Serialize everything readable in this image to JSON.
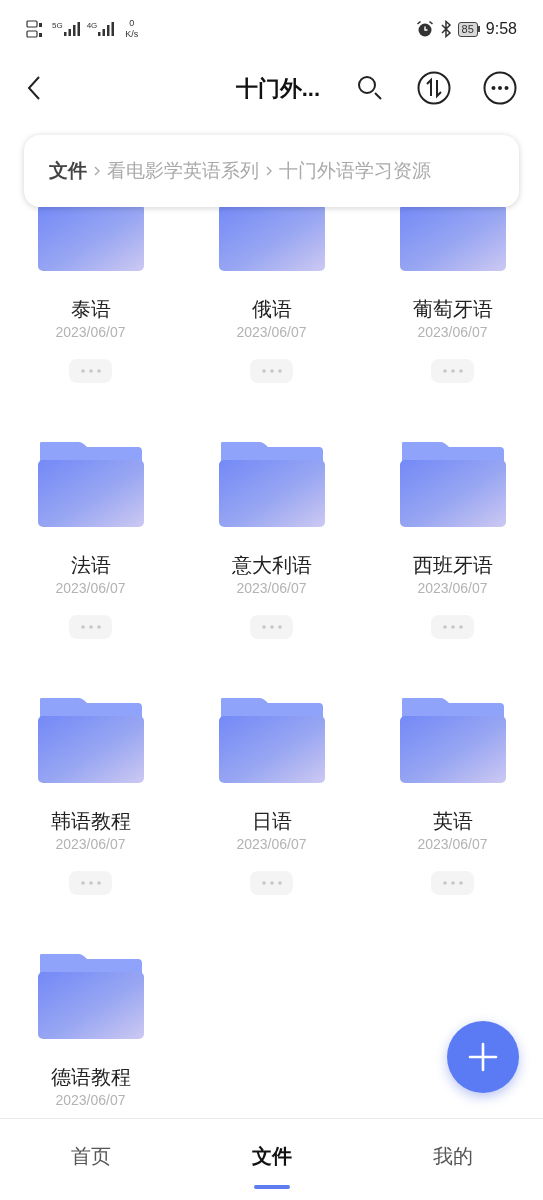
{
  "status_bar": {
    "sim_1": "5G",
    "sim_2": "4G",
    "speed_value": "0",
    "speed_unit": "K/s",
    "battery": "85",
    "time": "9:58"
  },
  "header": {
    "title": "十门外..."
  },
  "breadcrumb": [
    {
      "label": "文件",
      "kind": "root"
    },
    {
      "label": "看电影学英语系列",
      "kind": "path"
    },
    {
      "label": "十门外语学习资源",
      "kind": "path"
    }
  ],
  "folders": [
    {
      "name": "泰语",
      "date": "2023/06/07"
    },
    {
      "name": "俄语",
      "date": "2023/06/07"
    },
    {
      "name": "葡萄牙语",
      "date": "2023/06/07"
    },
    {
      "name": "法语",
      "date": "2023/06/07"
    },
    {
      "name": "意大利语",
      "date": "2023/06/07"
    },
    {
      "name": "西班牙语",
      "date": "2023/06/07"
    },
    {
      "name": "韩语教程",
      "date": "2023/06/07"
    },
    {
      "name": "日语",
      "date": "2023/06/07"
    },
    {
      "name": "英语",
      "date": "2023/06/07"
    },
    {
      "name": "德语教程",
      "date": "2023/06/07"
    }
  ],
  "bottom_nav": [
    {
      "label": "首页",
      "selected": false
    },
    {
      "label": "文件",
      "selected": true
    },
    {
      "label": "我的",
      "selected": false
    }
  ]
}
